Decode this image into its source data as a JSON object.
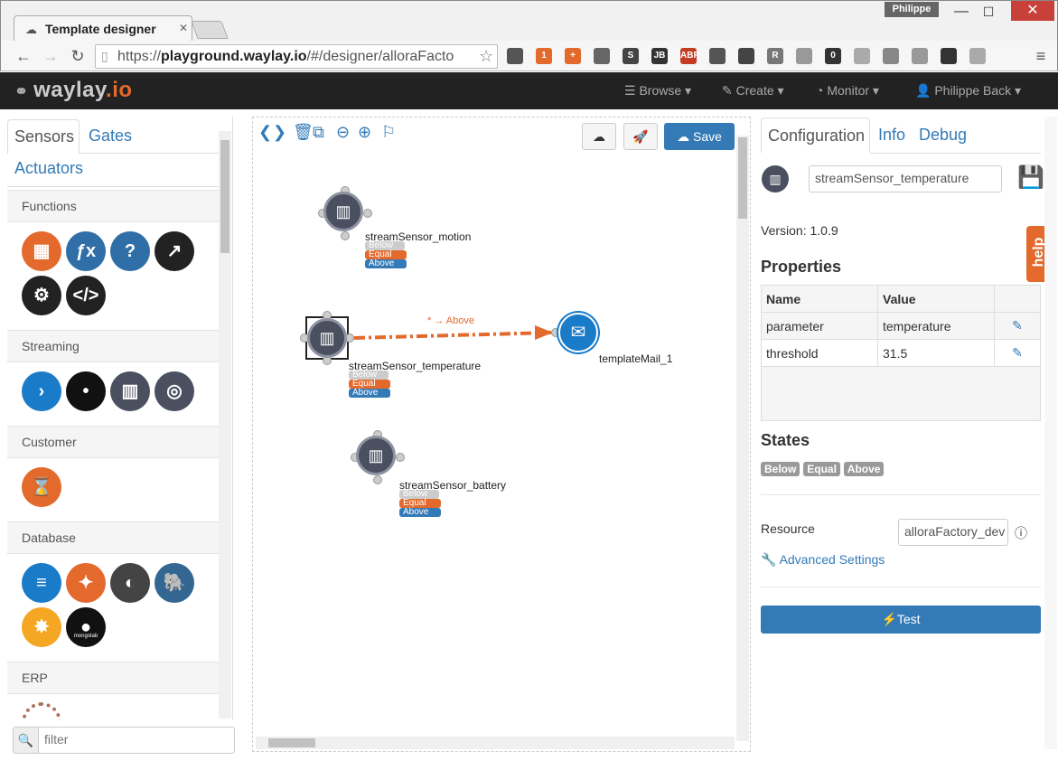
{
  "browser": {
    "tab_title": "Template designer",
    "user_badge": "Philippe",
    "url_prefix": "https://",
    "url_host": "playground.waylay.io",
    "url_path": "/#/designer/alloraFacto",
    "extensions": [
      {
        "icon": "lamp-icon",
        "label": "",
        "color": "#555"
      },
      {
        "icon": "dots-icon",
        "label": "1",
        "color": "#e4692c"
      },
      {
        "icon": "plus-icon",
        "label": "+",
        "color": "#e4692c"
      },
      {
        "icon": "pocket-icon",
        "label": "",
        "color": "#666"
      },
      {
        "icon": "s-icon",
        "label": "S",
        "color": "#444"
      },
      {
        "icon": "jb-icon",
        "label": "JB",
        "color": "#333"
      },
      {
        "icon": "abp-icon",
        "label": "ABP",
        "color": "#c23b22"
      },
      {
        "icon": "recycle-icon",
        "label": "",
        "color": "#555"
      },
      {
        "icon": "qr-icon",
        "label": "",
        "color": "#444"
      },
      {
        "icon": "r-icon",
        "label": "R",
        "color": "#777"
      },
      {
        "icon": "ghost-icon",
        "label": "",
        "color": "#999"
      },
      {
        "icon": "zero-icon",
        "label": "0",
        "color": "#333"
      },
      {
        "icon": "globe-icon",
        "label": "",
        "color": "#aaa"
      },
      {
        "icon": "dropbox-icon",
        "label": "",
        "color": "#888"
      },
      {
        "icon": "angular-icon",
        "label": "",
        "color": "#999"
      },
      {
        "icon": "screen-icon",
        "label": "",
        "color": "#333"
      },
      {
        "icon": "swirl-icon",
        "label": "",
        "color": "#aaa"
      }
    ]
  },
  "appnav": {
    "logo_main": "waylay",
    "logo_suffix": ".io",
    "browse": "Browse",
    "create": "Create",
    "monitor": "Monitor",
    "user": "Philippe Back"
  },
  "left": {
    "tabs": {
      "sensors": "Sensors",
      "gates": "Gates",
      "actuators": "Actuators"
    },
    "categories": {
      "functions": "Functions",
      "streaming": "Streaming",
      "customer": "Customer",
      "database": "Database",
      "erp": "ERP"
    },
    "functions_icons": [
      {
        "icon": "calculator-icon",
        "glyph": "▦",
        "color": "#e4692c"
      },
      {
        "icon": "function-icon",
        "glyph": "ƒx",
        "color": "#2f6ea6"
      },
      {
        "icon": "question-icon",
        "glyph": "?",
        "color": "#2f6ea6"
      },
      {
        "icon": "chart-line-icon",
        "glyph": "↗",
        "color": "#222"
      },
      {
        "icon": "gears-icon",
        "glyph": "⚙",
        "color": "#222"
      },
      {
        "icon": "code-icon",
        "glyph": "</>",
        "color": "#222"
      }
    ],
    "streaming_icons": [
      {
        "icon": "chevron-right-icon",
        "glyph": "›",
        "color": "#1a7bc9"
      },
      {
        "icon": "stream-dot-icon",
        "glyph": "•",
        "color": "#111"
      },
      {
        "icon": "bar-chart-icon",
        "glyph": "▥",
        "color": "#4a5060"
      },
      {
        "icon": "radar-icon",
        "glyph": "◎",
        "color": "#4a5060"
      }
    ],
    "customer_icons": [
      {
        "icon": "hourglass-icon",
        "glyph": "⌛",
        "color": "#e4692c"
      }
    ],
    "database_icons": [
      {
        "icon": "database-icon",
        "glyph": "≡",
        "color": "#1a7bc9"
      },
      {
        "icon": "cassandra-icon",
        "glyph": "✦",
        "color": "#e4692c"
      },
      {
        "icon": "mysql-icon",
        "glyph": "◐",
        "color": "#444"
      },
      {
        "icon": "postgres-icon",
        "glyph": "🐘",
        "color": "#336791"
      },
      {
        "icon": "hive-icon",
        "glyph": "✸",
        "color": "#f5a623"
      },
      {
        "icon": "mongolab-icon",
        "glyph": "●",
        "color": "#111",
        "caption": "mongolab"
      }
    ],
    "filter_placeholder": "filter"
  },
  "canvas": {
    "save_label": "Save",
    "edge_label": "* → Above",
    "nodes": [
      {
        "name": "streamSensor_motion",
        "states": [
          "Below",
          "Equal",
          "Above"
        ]
      },
      {
        "name": "streamSensor_temperature",
        "states": [
          "Below",
          "Equal",
          "Above"
        ]
      },
      {
        "name": "streamSensor_battery",
        "states": [
          "Below",
          "Equal",
          "Above"
        ]
      },
      {
        "name": "templateMail_1"
      }
    ]
  },
  "right": {
    "tabs": {
      "configuration": "Configuration",
      "info": "Info",
      "debug": "Debug"
    },
    "node_name": "streamSensor_temperature",
    "version": "Version: 1.0.9",
    "properties_heading": "Properties",
    "table": {
      "headers": [
        "Name",
        "Value",
        ""
      ],
      "rows": [
        {
          "name": "parameter",
          "value": "temperature"
        },
        {
          "name": "threshold",
          "value": "31.5"
        }
      ]
    },
    "states_heading": "States",
    "states": [
      "Below",
      "Equal",
      "Above"
    ],
    "resource_label": "Resource",
    "resource_value": "alloraFactory_dev",
    "advanced_label": "Advanced Settings",
    "test_label": "Test",
    "help_label": "help"
  },
  "colors": {
    "accent": "#337ab7",
    "brand": "#e4692c",
    "state_below": "#cccccc",
    "state_equal": "#e4692c",
    "state_above": "#337ab7"
  }
}
